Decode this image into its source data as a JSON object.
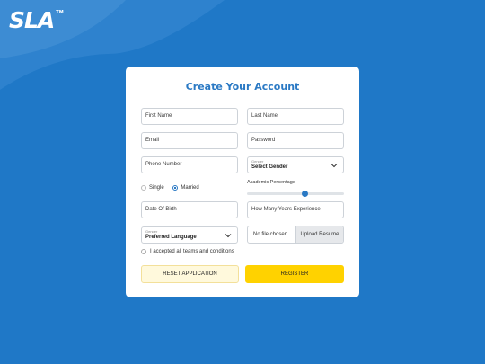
{
  "brand": {
    "logo_text": "SLA",
    "tm": "TM"
  },
  "form": {
    "title": "Create Your Account",
    "first_name_placeholder": "First Name",
    "last_name_placeholder": "Last Name",
    "email_placeholder": "Email",
    "password_placeholder": "Password",
    "phone_placeholder": "Phone Number",
    "gender_select": {
      "small_label": "Gender",
      "value": "Select Gender"
    },
    "marital": {
      "options": [
        "Single",
        "Married"
      ],
      "selected": "Married"
    },
    "academic": {
      "label": "Academic Percentage",
      "value_fraction": 0.6
    },
    "dob_placeholder": "Date Of Birth",
    "experience_placeholder": "How Many Years Experience",
    "language_select": {
      "small_label": "Gender",
      "value": "Preferred Language"
    },
    "file": {
      "status": "No file chosen",
      "button": "Upload Resume"
    },
    "terms_label": "I accepted all teams and conditions",
    "reset_label": "RESET APPLICATION",
    "register_label": "REGISTER"
  },
  "colors": {
    "background": "#1f78c7",
    "accent": "#2a79c4",
    "register": "#ffd200",
    "reset": "#fff9dc"
  }
}
